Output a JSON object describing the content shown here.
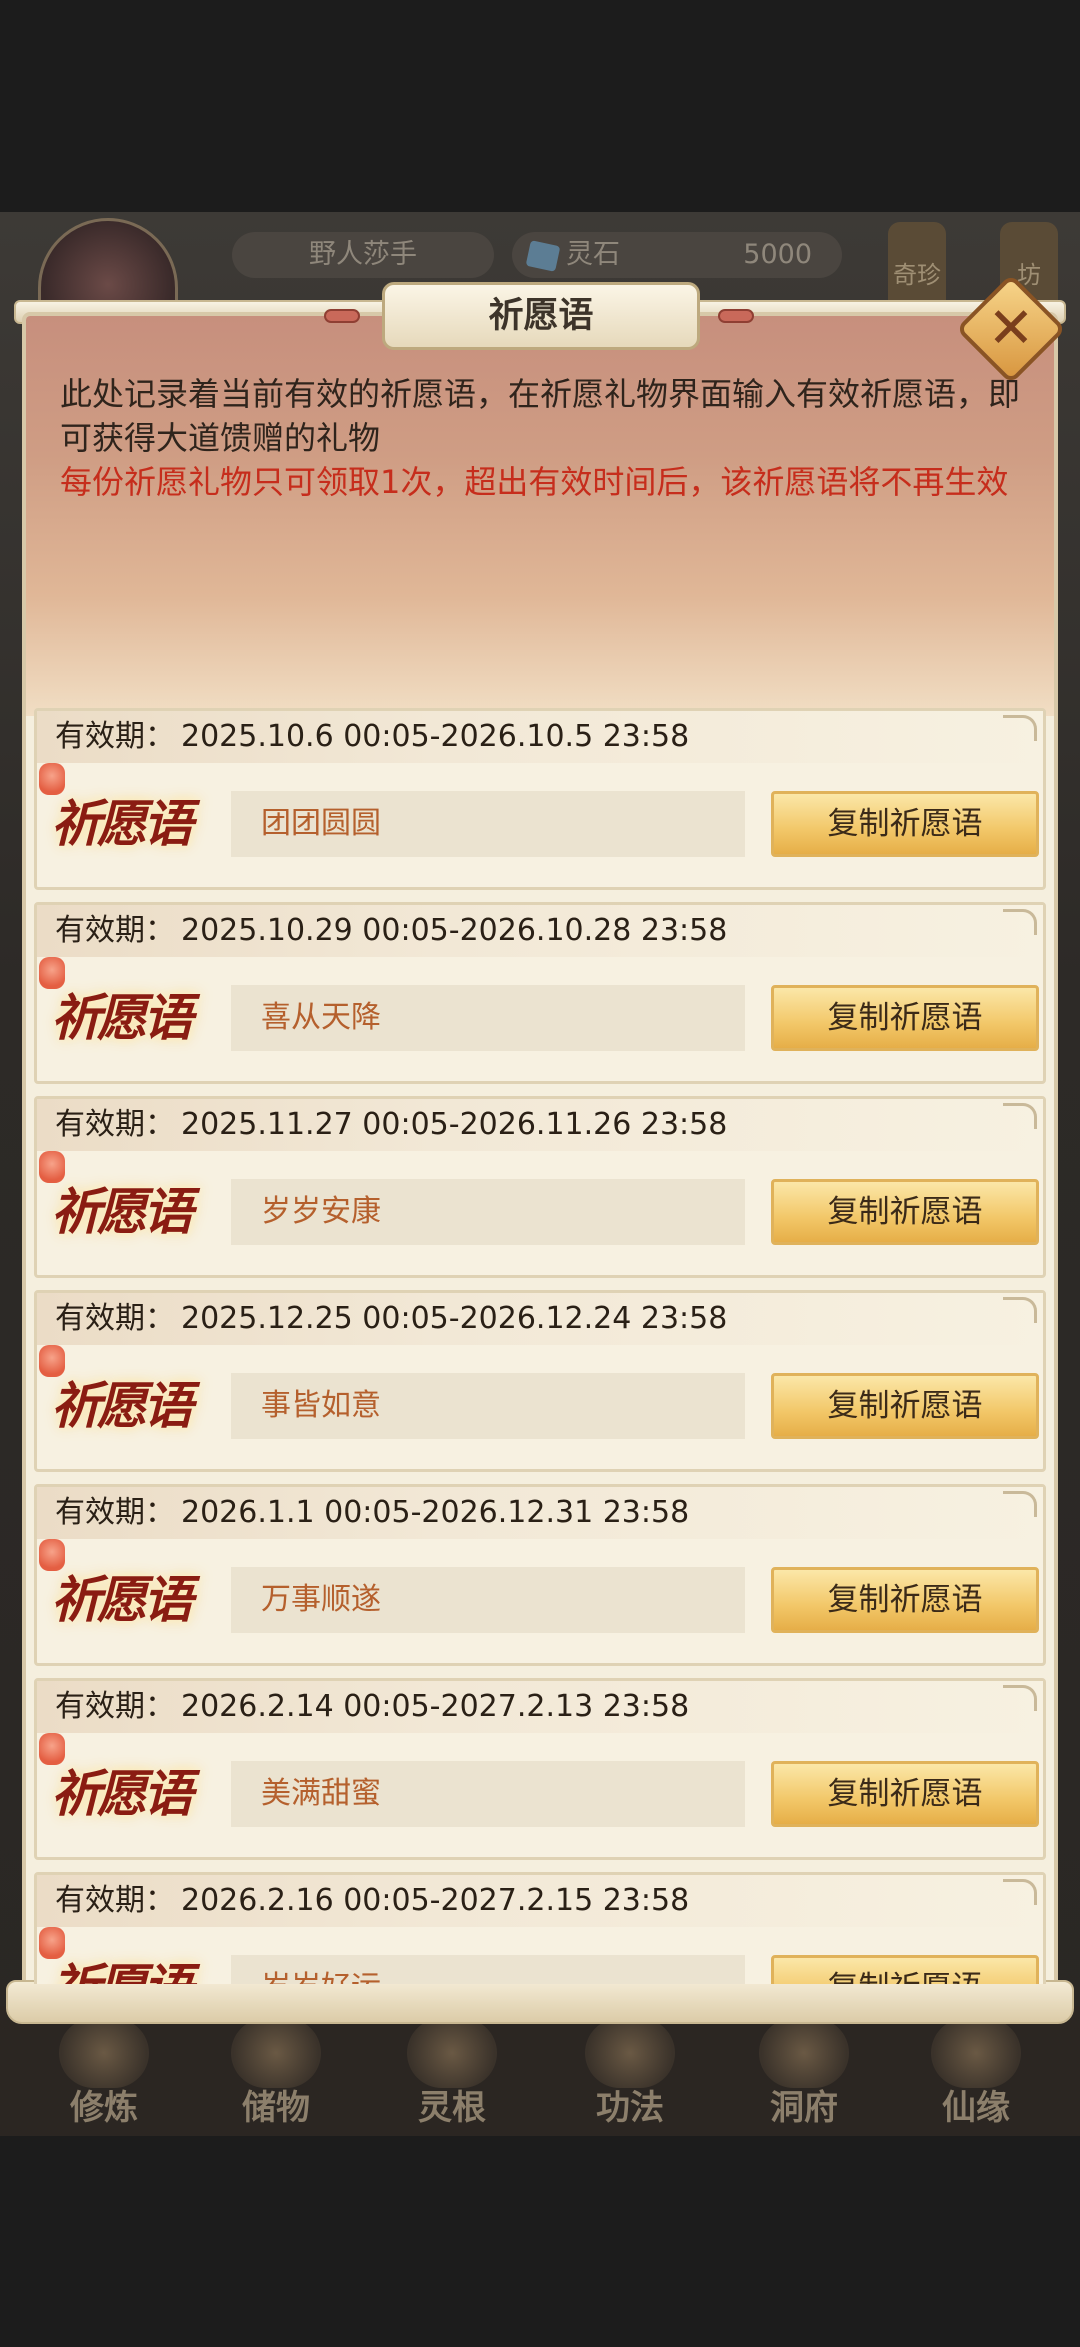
{
  "background": {
    "player_name": "野人莎手",
    "currency_label": "灵石",
    "currency_value": "5000",
    "side_buttons": [
      "奇珍",
      "坊"
    ],
    "nav": [
      "修炼",
      "储物",
      "灵根",
      "功法",
      "洞府",
      "仙缘"
    ]
  },
  "dialog": {
    "title": "祈愿语",
    "close_label": "✕",
    "intro": "此处记录着当前有效的祈愿语，在祈愿礼物界面输入有效祈愿语，即可获得大道馈赠的礼物",
    "warning": "每份祈愿礼物只可领取1次，超出有效时间后，该祈愿语将不再生效",
    "validity_label": "有效期：",
    "badge_text": "祈愿语",
    "copy_label": "复制祈愿语",
    "entries": [
      {
        "validity": "2025.10.6 00:05-2026.10.5 23:58",
        "phrase": "团团圆圆"
      },
      {
        "validity": "2025.10.29 00:05-2026.10.28 23:58",
        "phrase": "喜从天降"
      },
      {
        "validity": "2025.11.27 00:05-2026.11.26 23:58",
        "phrase": "岁岁安康"
      },
      {
        "validity": "2025.12.25 00:05-2026.12.24 23:58",
        "phrase": "事皆如意"
      },
      {
        "validity": "2026.1.1 00:05-2026.12.31 23:58",
        "phrase": "万事顺遂"
      },
      {
        "validity": "2026.2.14 00:05-2027.2.13 23:58",
        "phrase": "美满甜蜜"
      },
      {
        "validity": "2026.2.16 00:05-2027.2.15 23:58",
        "phrase": "岁岁好运"
      }
    ]
  }
}
